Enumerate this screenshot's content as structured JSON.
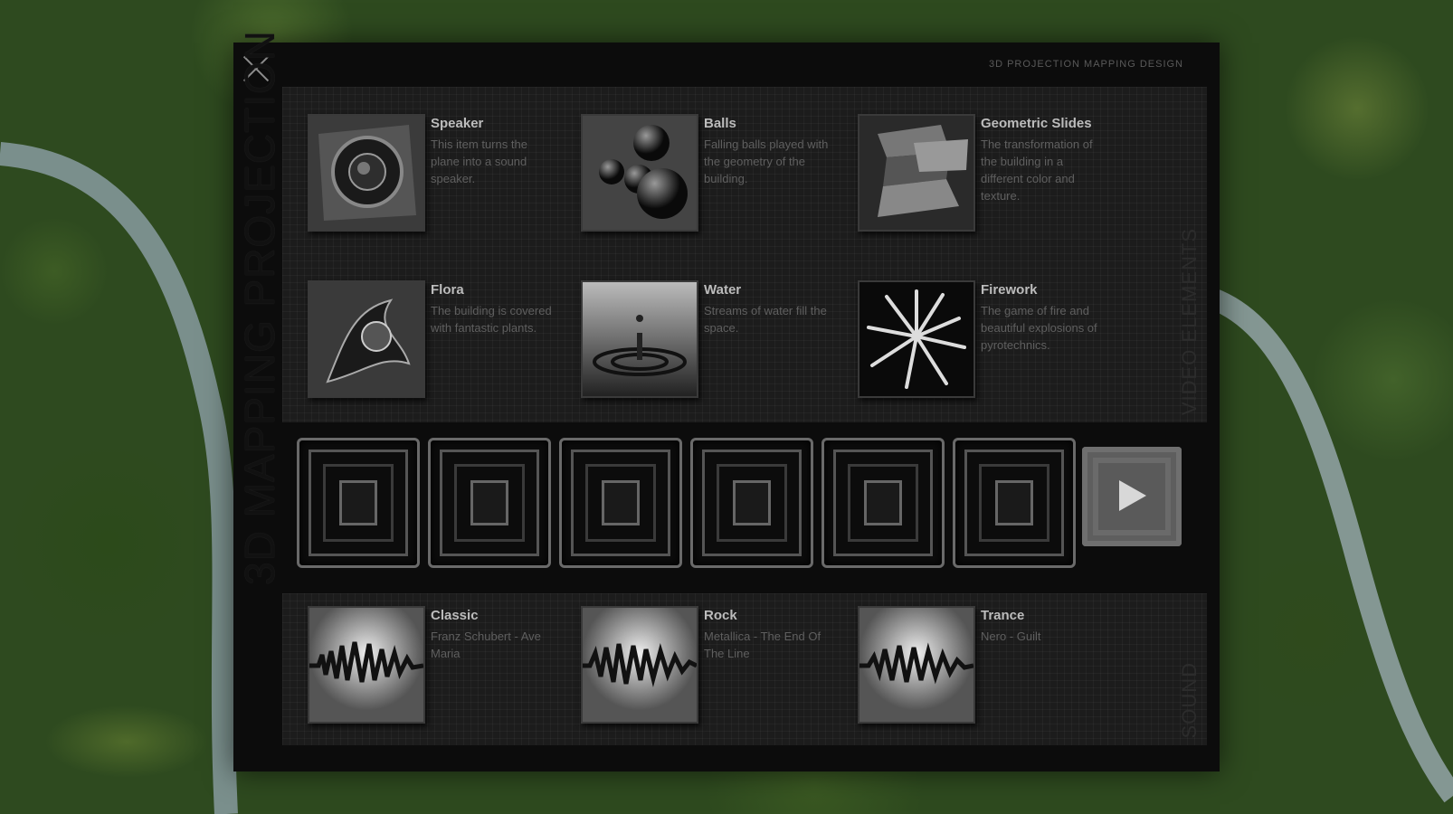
{
  "app": {
    "title": "3D MAPPING PROJECTION",
    "top_caption": "3D PROJECTION MAPPING DESIGN"
  },
  "video_section": {
    "label": "VIDEO ELEMENTS",
    "items": [
      {
        "title": "Speaker",
        "desc": "This item turns the plane into a sound speaker.",
        "icon": "speaker-icon"
      },
      {
        "title": "Balls",
        "desc": "Falling balls played with the geometry of the building.",
        "icon": "balls-icon"
      },
      {
        "title": "Geometric Slides",
        "desc": "The transformation of the building in a different color and texture.",
        "icon": "geometric-slides-icon"
      },
      {
        "title": "Flora",
        "desc": "The building is covered with fantastic plants.",
        "icon": "flora-icon"
      },
      {
        "title": "Water",
        "desc": "Streams of water fill the space.",
        "icon": "water-drop-icon"
      },
      {
        "title": "Firework",
        "desc": "The game of fire and beautiful explosions of pyrotechnics.",
        "icon": "firework-icon"
      }
    ]
  },
  "timeline": {
    "slot_count": 6,
    "play_label": "play"
  },
  "sound_section": {
    "label": "SOUND",
    "items": [
      {
        "title": "Classic",
        "desc": "Franz Schubert - Ave Maria"
      },
      {
        "title": "Rock",
        "desc": "Metallica - The End Of The Line"
      },
      {
        "title": "Trance",
        "desc": "Nero - Guilt"
      }
    ]
  },
  "colors": {
    "panel": "#0c0c0c",
    "section": "#1c1c1c",
    "title_text": "#bcbcbc",
    "desc_text": "#5f5f5f"
  }
}
